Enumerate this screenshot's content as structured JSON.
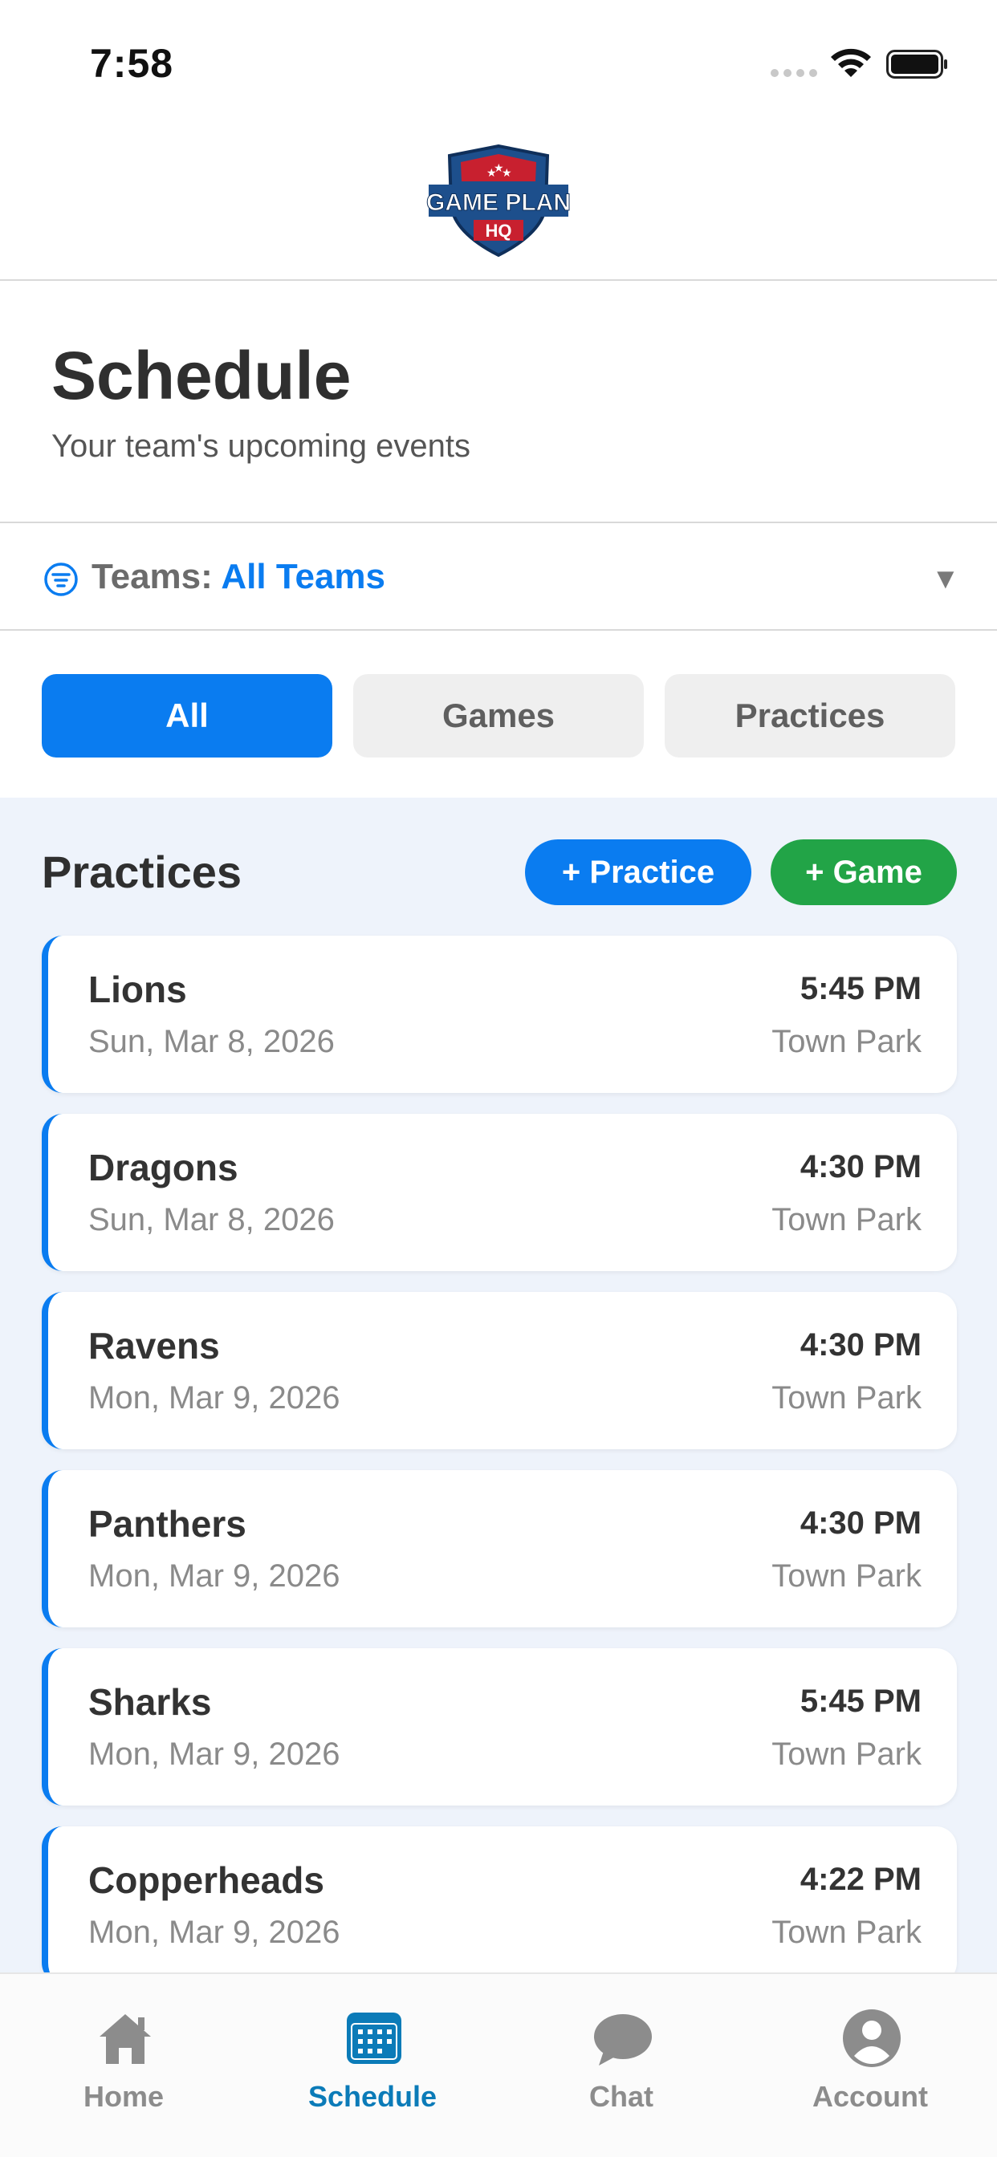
{
  "status_bar": {
    "time": "7:58"
  },
  "header": {
    "logo_top": "GAME PLAN",
    "logo_bottom": "HQ"
  },
  "page": {
    "title": "Schedule",
    "subtitle": "Your team's upcoming events"
  },
  "team_filter": {
    "label": "Teams:",
    "value": "All Teams",
    "caret": "▼"
  },
  "segments": [
    {
      "label": "All",
      "active": true
    },
    {
      "label": "Games",
      "active": false
    },
    {
      "label": "Practices",
      "active": false
    }
  ],
  "section": {
    "title": "Practices",
    "add_practice": "+ Practice",
    "add_game": "+ Game"
  },
  "events": [
    {
      "team": "Lions",
      "date": "Sun, Mar 8, 2026",
      "time": "5:45 PM",
      "location": "Town Park"
    },
    {
      "team": "Dragons",
      "date": "Sun, Mar 8, 2026",
      "time": "4:30 PM",
      "location": "Town Park"
    },
    {
      "team": "Ravens",
      "date": "Mon, Mar 9, 2026",
      "time": "4:30 PM",
      "location": "Town Park"
    },
    {
      "team": "Panthers",
      "date": "Mon, Mar 9, 2026",
      "time": "4:30 PM",
      "location": "Town Park"
    },
    {
      "team": "Sharks",
      "date": "Mon, Mar 9, 2026",
      "time": "5:45 PM",
      "location": "Town Park"
    },
    {
      "team": "Copperheads",
      "date": "Mon, Mar 9, 2026",
      "time": "4:22 PM",
      "location": "Town Park"
    }
  ],
  "tabs": [
    {
      "label": "Home",
      "icon": "home-icon"
    },
    {
      "label": "Schedule",
      "icon": "calendar-icon"
    },
    {
      "label": "Chat",
      "icon": "chat-bubble-icon"
    },
    {
      "label": "Account",
      "icon": "account-icon"
    }
  ],
  "colors": {
    "accent": "#0a7cf0",
    "game_green": "#22a447",
    "tab_active": "#0b7bb8"
  }
}
